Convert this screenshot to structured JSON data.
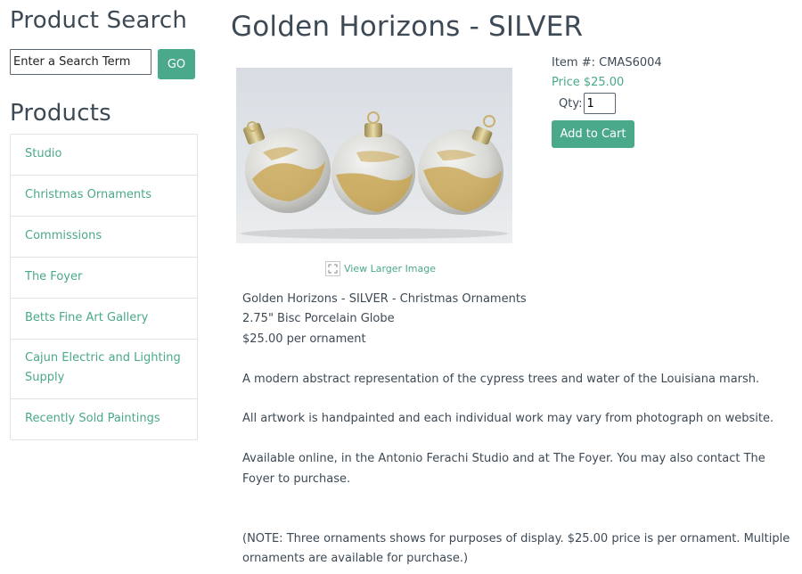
{
  "sidebar": {
    "search_title": "Product Search",
    "search_placeholder": "Enter a Search Term",
    "go_label": "GO",
    "products_title": "Products",
    "categories": [
      "Studio",
      "Christmas Ornaments",
      "Commissions",
      "The Foyer",
      "Betts Fine Art Gallery",
      "Cajun Electric and Lighting Supply",
      "Recently Sold Paintings"
    ]
  },
  "product": {
    "title": "Golden Horizons - SILVER",
    "item_number": "Item #: CMAS6004",
    "price": "Price $25.00",
    "qty_label": "Qty:",
    "qty_value": "1",
    "add_to_cart": "Add to Cart",
    "view_larger": "View Larger Image",
    "description": {
      "line1": "Golden Horizons - SILVER - Christmas Ornaments",
      "line2": "2.75\" Bisc Porcelain Globe",
      "line3": "$25.00 per ornament",
      "para1": "A modern abstract representation of the cypress trees and water of the Louisiana marsh.",
      "para2": "All artwork is handpainted and each individual work may vary from photograph on website.",
      "para3": "Available online, in the Antonio Ferachi Studio and at The Foyer.  You may also contact The Foyer to purchase.",
      "note": "(NOTE:  Three ornaments shows for purposes of display.  $25.00 price is per ornament.  Multiple ornaments are available for purchase.)"
    }
  },
  "colors": {
    "accent": "#4aa88b",
    "text": "#3d4a55",
    "border": "#e3e3e3"
  }
}
